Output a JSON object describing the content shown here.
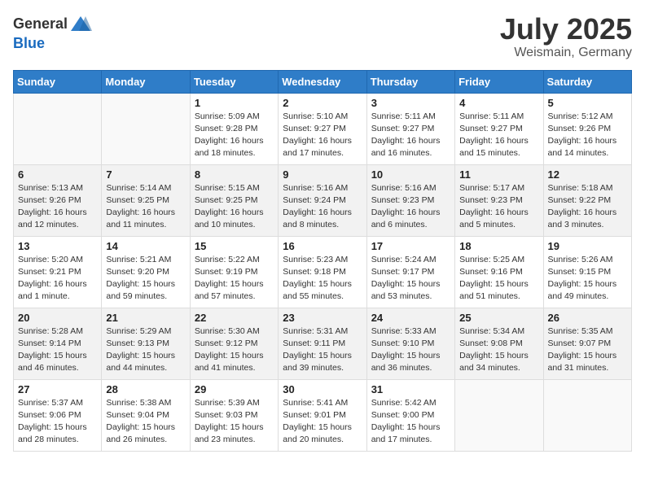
{
  "logo": {
    "general": "General",
    "blue": "Blue"
  },
  "title": {
    "month": "July 2025",
    "location": "Weismain, Germany"
  },
  "weekdays": [
    "Sunday",
    "Monday",
    "Tuesday",
    "Wednesday",
    "Thursday",
    "Friday",
    "Saturday"
  ],
  "weeks": [
    [
      {
        "day": "",
        "info": ""
      },
      {
        "day": "",
        "info": ""
      },
      {
        "day": "1",
        "info": "Sunrise: 5:09 AM\nSunset: 9:28 PM\nDaylight: 16 hours and 18 minutes."
      },
      {
        "day": "2",
        "info": "Sunrise: 5:10 AM\nSunset: 9:27 PM\nDaylight: 16 hours and 17 minutes."
      },
      {
        "day": "3",
        "info": "Sunrise: 5:11 AM\nSunset: 9:27 PM\nDaylight: 16 hours and 16 minutes."
      },
      {
        "day": "4",
        "info": "Sunrise: 5:11 AM\nSunset: 9:27 PM\nDaylight: 16 hours and 15 minutes."
      },
      {
        "day": "5",
        "info": "Sunrise: 5:12 AM\nSunset: 9:26 PM\nDaylight: 16 hours and 14 minutes."
      }
    ],
    [
      {
        "day": "6",
        "info": "Sunrise: 5:13 AM\nSunset: 9:26 PM\nDaylight: 16 hours and 12 minutes."
      },
      {
        "day": "7",
        "info": "Sunrise: 5:14 AM\nSunset: 9:25 PM\nDaylight: 16 hours and 11 minutes."
      },
      {
        "day": "8",
        "info": "Sunrise: 5:15 AM\nSunset: 9:25 PM\nDaylight: 16 hours and 10 minutes."
      },
      {
        "day": "9",
        "info": "Sunrise: 5:16 AM\nSunset: 9:24 PM\nDaylight: 16 hours and 8 minutes."
      },
      {
        "day": "10",
        "info": "Sunrise: 5:16 AM\nSunset: 9:23 PM\nDaylight: 16 hours and 6 minutes."
      },
      {
        "day": "11",
        "info": "Sunrise: 5:17 AM\nSunset: 9:23 PM\nDaylight: 16 hours and 5 minutes."
      },
      {
        "day": "12",
        "info": "Sunrise: 5:18 AM\nSunset: 9:22 PM\nDaylight: 16 hours and 3 minutes."
      }
    ],
    [
      {
        "day": "13",
        "info": "Sunrise: 5:20 AM\nSunset: 9:21 PM\nDaylight: 16 hours and 1 minute."
      },
      {
        "day": "14",
        "info": "Sunrise: 5:21 AM\nSunset: 9:20 PM\nDaylight: 15 hours and 59 minutes."
      },
      {
        "day": "15",
        "info": "Sunrise: 5:22 AM\nSunset: 9:19 PM\nDaylight: 15 hours and 57 minutes."
      },
      {
        "day": "16",
        "info": "Sunrise: 5:23 AM\nSunset: 9:18 PM\nDaylight: 15 hours and 55 minutes."
      },
      {
        "day": "17",
        "info": "Sunrise: 5:24 AM\nSunset: 9:17 PM\nDaylight: 15 hours and 53 minutes."
      },
      {
        "day": "18",
        "info": "Sunrise: 5:25 AM\nSunset: 9:16 PM\nDaylight: 15 hours and 51 minutes."
      },
      {
        "day": "19",
        "info": "Sunrise: 5:26 AM\nSunset: 9:15 PM\nDaylight: 15 hours and 49 minutes."
      }
    ],
    [
      {
        "day": "20",
        "info": "Sunrise: 5:28 AM\nSunset: 9:14 PM\nDaylight: 15 hours and 46 minutes."
      },
      {
        "day": "21",
        "info": "Sunrise: 5:29 AM\nSunset: 9:13 PM\nDaylight: 15 hours and 44 minutes."
      },
      {
        "day": "22",
        "info": "Sunrise: 5:30 AM\nSunset: 9:12 PM\nDaylight: 15 hours and 41 minutes."
      },
      {
        "day": "23",
        "info": "Sunrise: 5:31 AM\nSunset: 9:11 PM\nDaylight: 15 hours and 39 minutes."
      },
      {
        "day": "24",
        "info": "Sunrise: 5:33 AM\nSunset: 9:10 PM\nDaylight: 15 hours and 36 minutes."
      },
      {
        "day": "25",
        "info": "Sunrise: 5:34 AM\nSunset: 9:08 PM\nDaylight: 15 hours and 34 minutes."
      },
      {
        "day": "26",
        "info": "Sunrise: 5:35 AM\nSunset: 9:07 PM\nDaylight: 15 hours and 31 minutes."
      }
    ],
    [
      {
        "day": "27",
        "info": "Sunrise: 5:37 AM\nSunset: 9:06 PM\nDaylight: 15 hours and 28 minutes."
      },
      {
        "day": "28",
        "info": "Sunrise: 5:38 AM\nSunset: 9:04 PM\nDaylight: 15 hours and 26 minutes."
      },
      {
        "day": "29",
        "info": "Sunrise: 5:39 AM\nSunset: 9:03 PM\nDaylight: 15 hours and 23 minutes."
      },
      {
        "day": "30",
        "info": "Sunrise: 5:41 AM\nSunset: 9:01 PM\nDaylight: 15 hours and 20 minutes."
      },
      {
        "day": "31",
        "info": "Sunrise: 5:42 AM\nSunset: 9:00 PM\nDaylight: 15 hours and 17 minutes."
      },
      {
        "day": "",
        "info": ""
      },
      {
        "day": "",
        "info": ""
      }
    ]
  ]
}
